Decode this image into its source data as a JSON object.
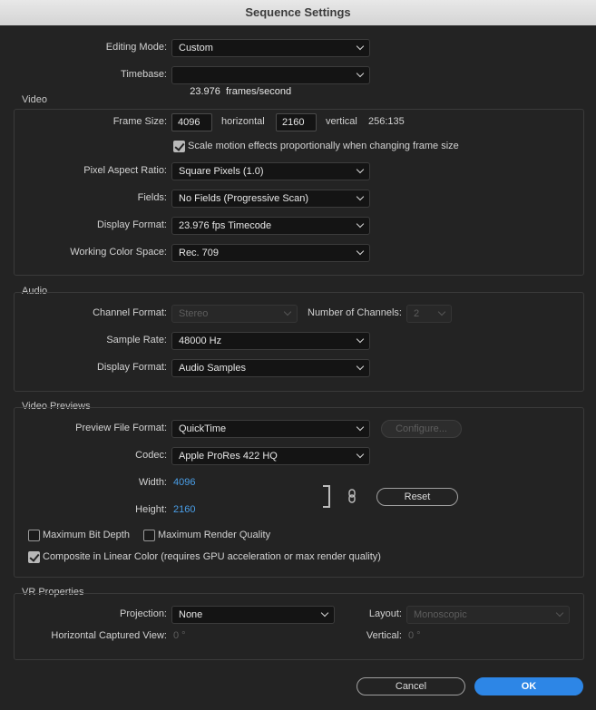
{
  "window": {
    "title": "Sequence Settings"
  },
  "general": {
    "editing_mode": {
      "label": "Editing Mode:",
      "value": "Custom"
    },
    "timebase": {
      "label": "Timebase:",
      "value": "23.976  frames/second"
    }
  },
  "video": {
    "section_title": "Video",
    "frame_size": {
      "label": "Frame Size:",
      "width": "4096",
      "horizontal_label": "horizontal",
      "height": "2160",
      "vertical_label": "vertical",
      "ratio": "256:135"
    },
    "scale_motion": {
      "label": "Scale motion effects proportionally when changing frame size",
      "checked": true
    },
    "pixel_aspect_ratio": {
      "label": "Pixel Aspect Ratio:",
      "value": "Square Pixels (1.0)"
    },
    "fields": {
      "label": "Fields:",
      "value": "No Fields (Progressive Scan)"
    },
    "display_format": {
      "label": "Display Format:",
      "value": "23.976 fps Timecode"
    },
    "working_color_space": {
      "label": "Working Color Space:",
      "value": "Rec. 709"
    }
  },
  "audio": {
    "section_title": "Audio",
    "channel_format": {
      "label": "Channel Format:",
      "value": "Stereo"
    },
    "number_of_channels": {
      "label": "Number of Channels:",
      "value": "2"
    },
    "sample_rate": {
      "label": "Sample Rate:",
      "value": "48000 Hz"
    },
    "display_format": {
      "label": "Display Format:",
      "value": "Audio Samples"
    }
  },
  "video_previews": {
    "section_title": "Video Previews",
    "preview_file_format": {
      "label": "Preview File Format:",
      "value": "QuickTime"
    },
    "configure_label": "Configure...",
    "codec": {
      "label": "Codec:",
      "value": "Apple ProRes 422 HQ"
    },
    "width": {
      "label": "Width:",
      "value": "4096"
    },
    "height": {
      "label": "Height:",
      "value": "2160"
    },
    "reset_label": "Reset",
    "max_bit_depth": {
      "label": "Maximum Bit Depth",
      "checked": false
    },
    "max_render_quality": {
      "label": "Maximum Render Quality",
      "checked": false
    },
    "composite_linear": {
      "label": "Composite in Linear Color (requires GPU acceleration or max render quality)",
      "checked": true
    }
  },
  "vr": {
    "section_title": "VR Properties",
    "projection": {
      "label": "Projection:",
      "value": "None"
    },
    "layout": {
      "label": "Layout:",
      "value": "Monoscopic"
    },
    "horizontal_view": {
      "label": "Horizontal Captured View:",
      "value": "0 °"
    },
    "vertical": {
      "label": "Vertical:",
      "value": "0 °"
    }
  },
  "footer": {
    "cancel_label": "Cancel",
    "ok_label": "OK"
  },
  "colors": {
    "accent": "#2d86e6",
    "link": "#4a9fe8",
    "background": "#232323"
  }
}
